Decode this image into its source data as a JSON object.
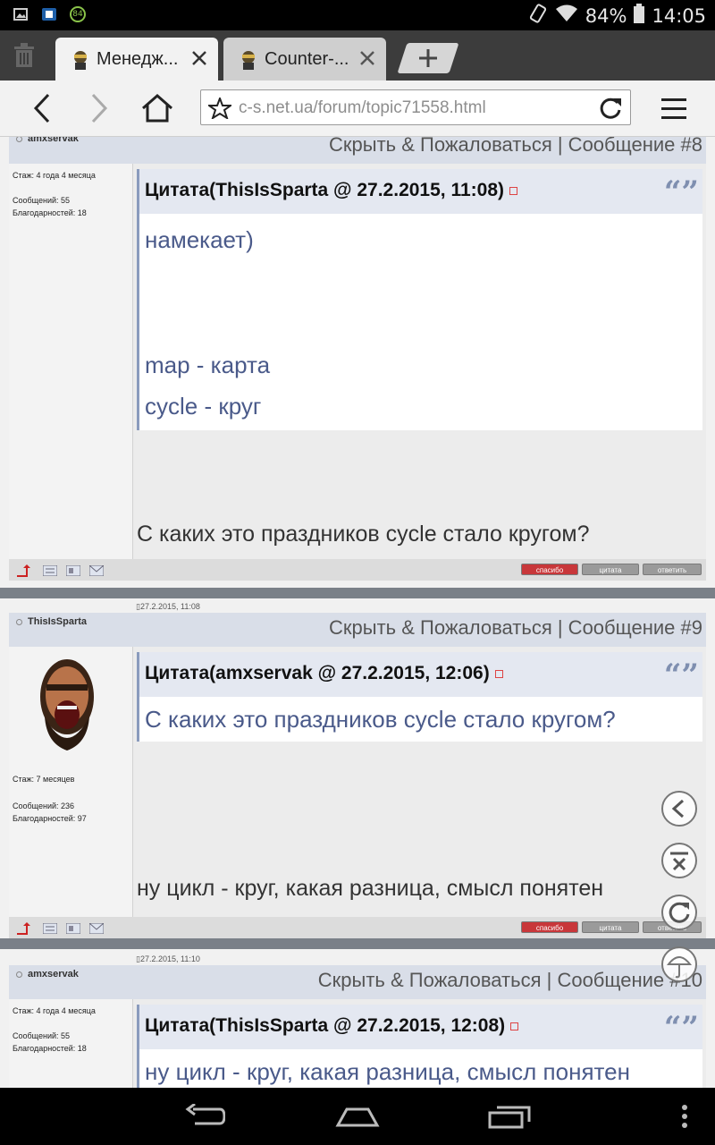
{
  "status_bar": {
    "battery_percent": "84%",
    "time": "14:05",
    "badge": "84"
  },
  "tabs": [
    {
      "title": "Менедж..."
    },
    {
      "title": "Counter-..."
    }
  ],
  "url_bar": {
    "url": "c-s.net.ua/forum/topic71558.html"
  },
  "actions_text": "Скрыть & Пожаловаться | Сообщение ",
  "posts": [
    {
      "user": "amxservak",
      "date": "",
      "actions": "Скрыть & Пожаловаться | Сообщение #8",
      "stats": {
        "stazh": "Стаж: 4 года 4 месяца",
        "messages": "Сообщений: 55",
        "thanks": "Благодарностей: 18"
      },
      "quote_header": "Цитата(ThisIsSparta @ 27.2.2015, 11:08)",
      "quote_lines": [
        "намекает)",
        "map - карта",
        "cycle - круг"
      ],
      "text": "С каких это праздников cycle стало кругом?"
    },
    {
      "user": "ThisIsSparta",
      "date": "27.2.2015, 11:08",
      "actions": "Скрыть & Пожаловаться | Сообщение #9",
      "stats": {
        "stazh": "Стаж: 7 месяцев",
        "messages": "Сообщений: 236",
        "thanks": "Благодарностей: 97"
      },
      "quote_header": "Цитата(amxservak @ 27.2.2015, 12:06)",
      "quote_lines": [
        "С каких это праздников cycle стало кругом?"
      ],
      "text": "ну цикл - круг, какая разница, смысл понятен"
    },
    {
      "user": "amxservak",
      "date": "27.2.2015, 11:10",
      "actions": "Скрыть & Пожаловаться | Сообщение #10",
      "stats": {
        "stazh": "Стаж: 4 года 4 месяца",
        "messages": "Сообщений: 55",
        "thanks": "Благодарностей: 18"
      },
      "quote_header": "Цитата(ThisIsSparta @ 27.2.2015, 12:08)",
      "quote_lines": [
        "ну цикл - круг, какая разница, смысл понятен"
      ],
      "text": ""
    }
  ],
  "post_buttons": {
    "thanks": "спасибо",
    "quote": "цитата",
    "reply": "ответить"
  },
  "colors": {
    "quote_text": "#4a5a8a",
    "header_bg": "#d9dee8",
    "separator": "#7a8088"
  }
}
